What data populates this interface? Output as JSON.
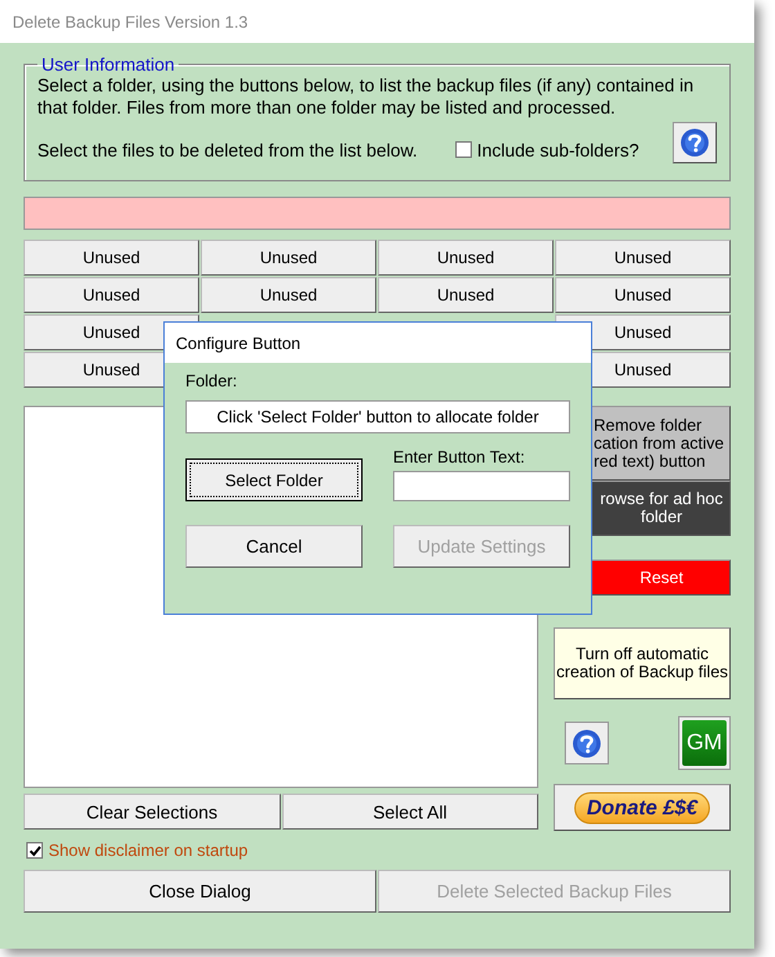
{
  "window": {
    "title": "Delete Backup Files Version 1.3"
  },
  "user_information": {
    "legend": "User Information",
    "description": "Select a folder, using the buttons below, to list the backup files (if any) contained in that folder. Files from more than one folder may be listed and processed.",
    "instruction": "Select the files to be deleted from the list below.",
    "include_subfolders": {
      "label": "Include sub-folders?",
      "checked": false
    }
  },
  "folder_buttons": [
    [
      {
        "label": "Unused"
      },
      {
        "label": "Unused"
      },
      {
        "label": "Unused"
      },
      {
        "label": "Unused"
      }
    ],
    [
      {
        "label": "Unused"
      },
      {
        "label": "Unused"
      },
      {
        "label": "Unused"
      },
      {
        "label": "Unused"
      }
    ],
    [
      {
        "label": "Unused"
      },
      {
        "label": "Unused"
      }
    ],
    [
      {
        "label": "Unused"
      },
      {
        "label": "Unused"
      }
    ]
  ],
  "side_buttons": [
    {
      "kind": "remove",
      "lines": [
        "Remove folder",
        "cation from active",
        "red text) button"
      ]
    },
    {
      "kind": "browse",
      "lines": [
        "rowse for ad hoc",
        "folder"
      ]
    },
    {
      "kind": "reset",
      "lines": [
        "Reset"
      ]
    },
    {
      "kind": "turn_off",
      "lines": [
        "Turn off automatic",
        "creation of Backup files"
      ]
    }
  ],
  "gm_button": {
    "label": "GM"
  },
  "donate_button": {
    "label": "Donate £$€"
  },
  "list_buttons": [
    {
      "label": "Clear Selections"
    },
    {
      "label": "Select All"
    }
  ],
  "show_disclaimer": {
    "label": "Show disclaimer on startup",
    "checked": true
  },
  "footer_buttons": [
    {
      "label": "Close Dialog",
      "disabled": false
    },
    {
      "label": "Delete Selected Backup Files",
      "disabled": true
    }
  ],
  "dialog": {
    "title": "Configure Button",
    "folder_label": "Folder:",
    "folder_value": "Click 'Select Folder' button to allocate folder",
    "select_button": "Select Folder",
    "button_text_label": "Enter Button Text:",
    "buttons": [
      {
        "label": "Cancel",
        "disabled": false
      },
      {
        "label": "Update Settings",
        "disabled": true
      }
    ]
  }
}
